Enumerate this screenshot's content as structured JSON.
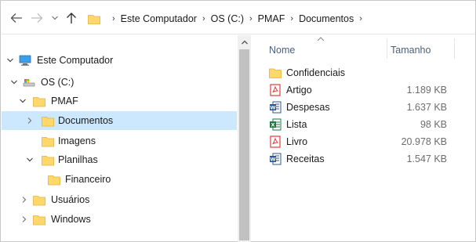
{
  "address_bar": {
    "breadcrumbs": [
      "Este Computador",
      "OS (C:)",
      "PMAF",
      "Documentos"
    ],
    "separator": "›"
  },
  "navigation": {
    "back_icon": "arrow-left-icon",
    "forward_icon": "arrow-right-icon",
    "recent_icon": "chevron-down-icon",
    "up_icon": "arrow-up-icon"
  },
  "tree": {
    "items": [
      {
        "label": "Este Computador",
        "icon": "computer-icon",
        "expanded": true
      },
      {
        "label": "OS (C:)",
        "icon": "drive-icon",
        "expanded": true
      },
      {
        "label": "PMAF",
        "icon": "folder-icon",
        "expanded": true
      },
      {
        "label": "Documentos",
        "icon": "folder-icon",
        "expanded": false,
        "selected": true
      },
      {
        "label": "Imagens",
        "icon": "folder-icon"
      },
      {
        "label": "Planilhas",
        "icon": "folder-icon",
        "expanded": true
      },
      {
        "label": "Financeiro",
        "icon": "folder-icon"
      },
      {
        "label": "Usuários",
        "icon": "folder-icon",
        "expanded": false
      },
      {
        "label": "Windows",
        "icon": "folder-icon",
        "expanded": false
      }
    ]
  },
  "file_list": {
    "columns": {
      "name": "Nome",
      "size": "Tamanho"
    },
    "files": [
      {
        "name": "Confidenciais",
        "size": "",
        "icon": "folder-icon"
      },
      {
        "name": "Artigo",
        "size": "1.189 KB",
        "icon": "pdf-icon"
      },
      {
        "name": "Despesas",
        "size": "1.637 KB",
        "icon": "word-icon"
      },
      {
        "name": "Lista",
        "size": "98 KB",
        "icon": "excel-icon"
      },
      {
        "name": "Livro",
        "size": "20.978 KB",
        "icon": "pdf-icon"
      },
      {
        "name": "Receitas",
        "size": "1.547 KB",
        "icon": "word-icon"
      }
    ]
  },
  "colors": {
    "selection": "#cce8ff",
    "folder": "#ffd86b",
    "pdf": "#e03b3b",
    "word": "#2b5797",
    "excel": "#1d7a45",
    "header_text": "#4c607a"
  }
}
